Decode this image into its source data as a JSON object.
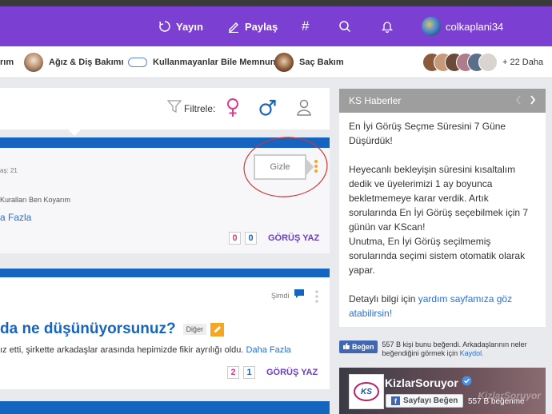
{
  "topbar": {
    "publish_label": "Yayın",
    "share_label": "Paylaş",
    "hashtag_symbol": "#",
    "username": "colkaplani34",
    "bg_color": "#7b3fd2"
  },
  "categories": {
    "items": [
      {
        "label": "rım"
      },
      {
        "label": "Ağız & Diş Bakımı"
      },
      {
        "label": "Kullanmayanlar Bile Memnun"
      },
      {
        "label": "Saç Bakım"
      }
    ],
    "more_label": "+ 22 Daha"
  },
  "filter_bar": {
    "label": "Filtrele:"
  },
  "post1": {
    "meta": "aş: 21",
    "tag": "Kuralları Ben Koyarım",
    "more_link": "a Fazla",
    "hide_label": "Gizle",
    "count_pink": "0",
    "count_blue": "0",
    "action_label": "GÖRÜŞ YAZ"
  },
  "post2": {
    "time": "Şimdi",
    "title": "da ne düşünüyorsunuz?",
    "category": "Diğer",
    "excerpt": "ız etti, şirkette arkadaşlar arasında hepimizde fikir ayrılığı oldu.",
    "more_link": "Daha Fazla",
    "count_pink": "2",
    "count_blue": "1",
    "action_label": "GÖRÜŞ YAZ"
  },
  "sidebar": {
    "title": "KS Haberler",
    "headline": "En İyi Görüş Seçme Süresini 7 Güne Düşürdük!",
    "body": "Heyecanlı bekleyişin süresini kısaltalım dedik ve üyelerimizi 1 ay boyunca bekletmemeye karar verdik. Artık sorularında En İyi Görüş seçebilmek için 7 günün var KScan!",
    "body2": "Unutma, En İyi Görüş seçilmemiş sorularında seçimi sistem otomatik olarak yapar.",
    "detail_prefix": "Detaylı bilgi için",
    "detail_link": "yardım sayfamıza göz atabilirsin!"
  },
  "fb_like": {
    "button": "Beğen",
    "text": "557 B kişi bunu beğendi. Arkadaşlarının neler beğendiğini görmek için",
    "signup_link": "Kaydol."
  },
  "fb_page": {
    "name": "KizlarSoruyor",
    "like_button": "Sayfayı Beğen",
    "likes": "557 B beğenme",
    "logo_text": "KS",
    "watermark": "KizlarSoruyor"
  }
}
